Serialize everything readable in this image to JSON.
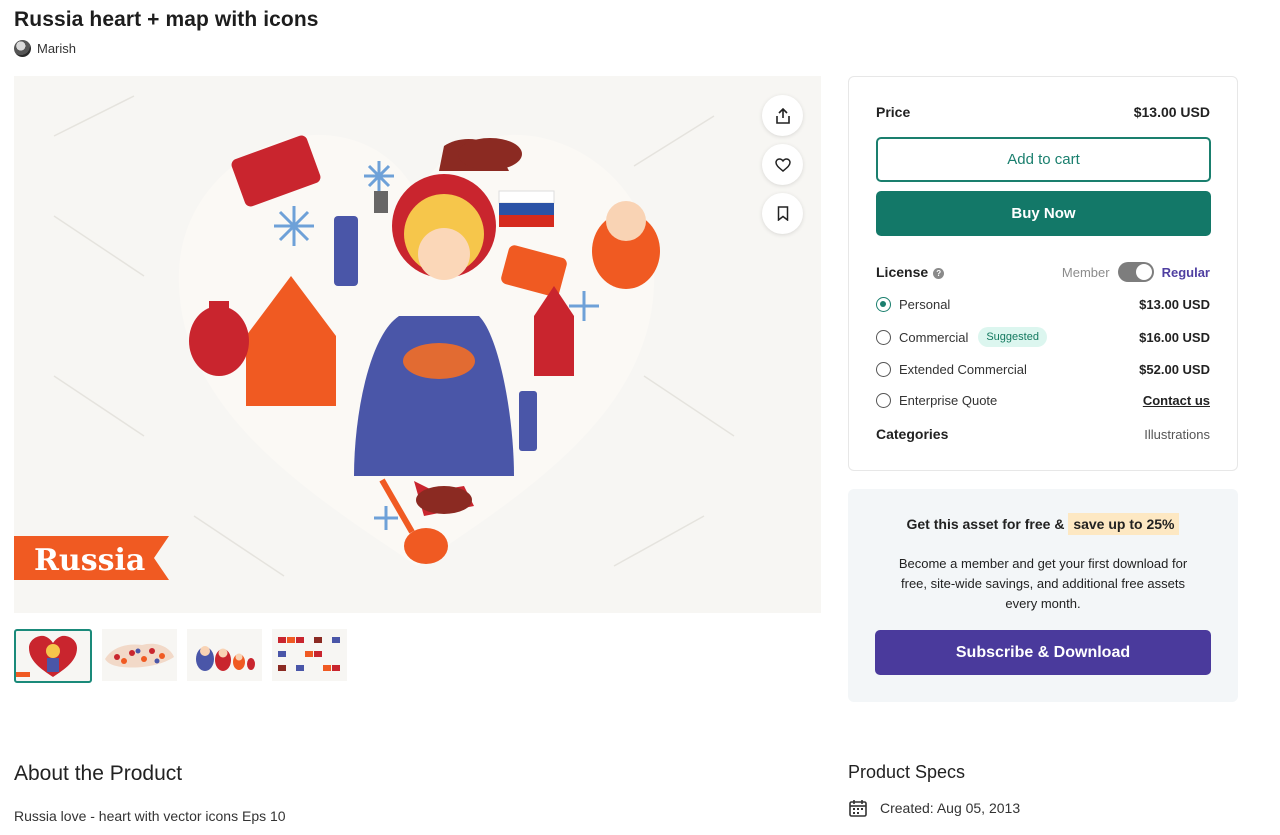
{
  "product": {
    "title": "Russia heart + map with icons",
    "author": "Marish"
  },
  "hero": {
    "banner_text": "Russia",
    "flag_colors": [
      "#ffffff",
      "#2b53a7",
      "#d52b1e"
    ],
    "accent_colors": {
      "red": "#c9252e",
      "orange": "#f05a22",
      "blue": "#4a56a8",
      "yellow": "#f6c64b"
    }
  },
  "actions": {
    "share_icon": "share-icon",
    "like_icon": "heart-icon",
    "save_icon": "bookmark-icon"
  },
  "purchase": {
    "price_label": "Price",
    "price_value": "$13.00 USD",
    "add_to_cart": "Add to cart",
    "buy_now": "Buy Now",
    "license_label": "License",
    "license_help": "?",
    "toggle_left": "Member",
    "toggle_right": "Regular",
    "options": [
      {
        "label": "Personal",
        "price": "$13.00 USD",
        "selected": true
      },
      {
        "label": "Commercial",
        "price": "$16.00 USD",
        "badge": "Suggested"
      },
      {
        "label": "Extended Commercial",
        "price": "$52.00 USD"
      },
      {
        "label": "Enterprise Quote",
        "link": "Contact us"
      }
    ],
    "categories_label": "Categories",
    "categories_value": "Illustrations"
  },
  "promo": {
    "head_prefix": "Get this asset for free &",
    "head_highlight": "save up to 25%",
    "body": "Become a member and get your first download for free, site-wide savings, and additional free assets every month.",
    "button": "Subscribe & Download"
  },
  "about": {
    "heading": "About the Product",
    "description": "Russia love - heart with vector icons Eps 10"
  },
  "specs": {
    "heading": "Product Specs",
    "created": "Created: Aug 05, 2013"
  },
  "colors": {
    "teal": "#137868",
    "purple": "#4a3a9c"
  }
}
